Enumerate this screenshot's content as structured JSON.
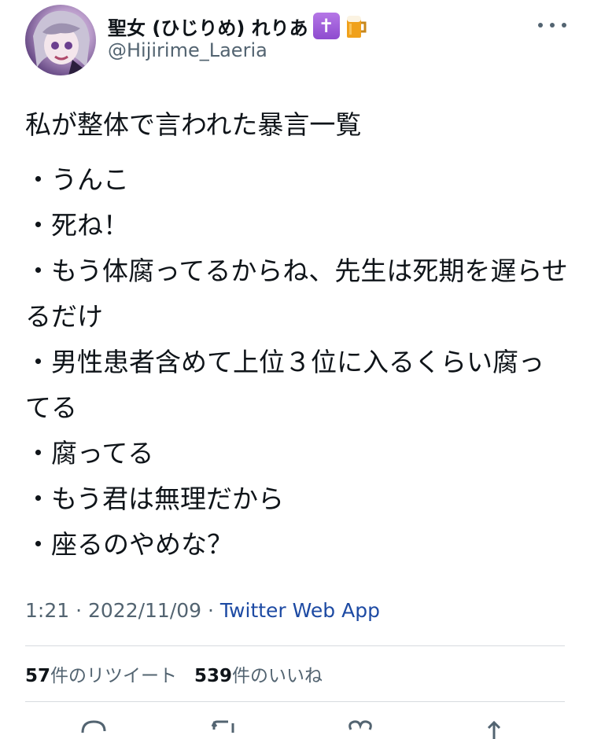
{
  "user": {
    "display_name": "聖女 (ひじりめ) れりあ",
    "handle": "@Hijirime_Laeria",
    "emoji": [
      "cross-emoji",
      "beer-emoji"
    ]
  },
  "tweet": {
    "title": "私が整体で言われた暴言一覧",
    "lines": [
      "・うんこ",
      "・死ね！",
      "・もう体腐ってるからね、先生は死期を遅らせるだけ",
      "・男性患者含めて上位３位に入るくらい腐ってる",
      "・腐ってる",
      "・もう君は無理だから",
      "・座るのやめな？"
    ],
    "time": "1:21",
    "date": "2022/11/09",
    "sep": " · ",
    "source": "Twitter Web App"
  },
  "stats": {
    "retweets_count": "57",
    "retweets_label": "件のリツイート",
    "likes_count": "539",
    "likes_label": "件のいいね"
  },
  "icons": [
    "more-icon",
    "reply-icon",
    "retweet-icon",
    "like-icon",
    "share-icon"
  ]
}
